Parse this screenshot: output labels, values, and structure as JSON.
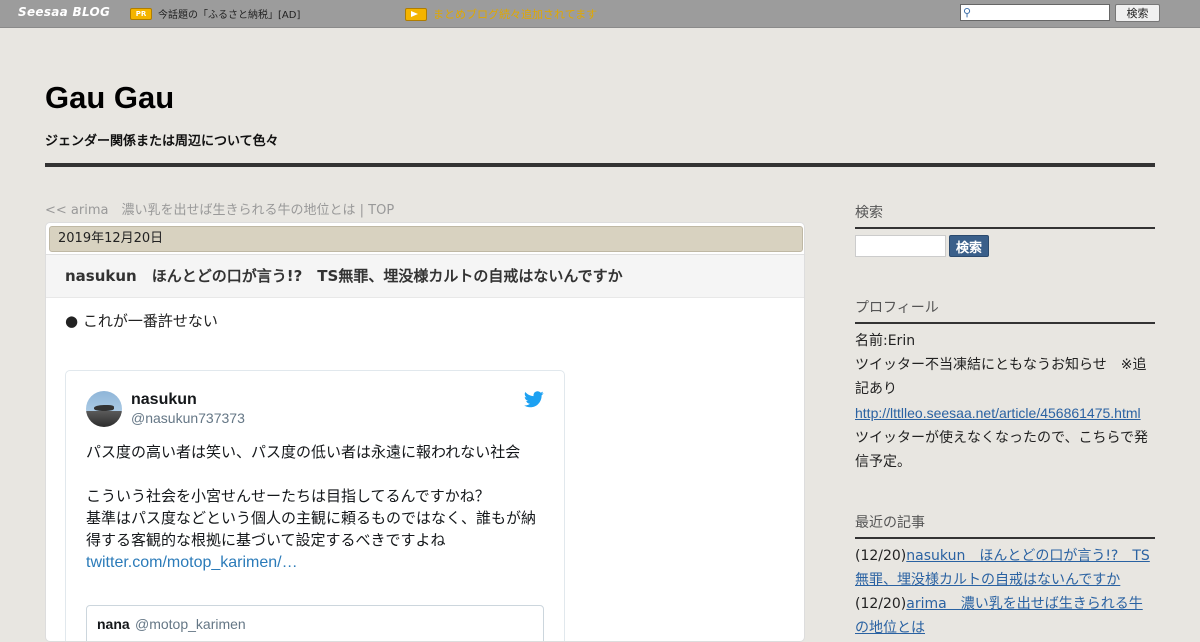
{
  "topbar": {
    "logo": "Seesaa BLOG",
    "pr_badge": "PR",
    "pr_text": "今話題の「ふるさと納税」[AD]",
    "matome_text": "まとめブログ続々追加されてます",
    "search_button": "検索"
  },
  "header": {
    "title": "Gau Gau",
    "subtitle": "ジェンダー関係または周辺について色々"
  },
  "nav": {
    "prev": "<< arima　濃い乳を出せば生きられる牛の地位とは",
    "separator": " | ",
    "top": "TOP"
  },
  "article": {
    "date": "2019年12月20日",
    "title": "nasukun　ほんとどの口が言う!?　TS無罪、埋没様カルトの自戒はないんですか",
    "bullet": "● これが一番許せない"
  },
  "tweet": {
    "name": "nasukun",
    "handle": "@nasukun737373",
    "line1": "パス度の高い者は笑い、パス度の低い者は永遠に報われない社会",
    "line2": "こういう社会を小宮せんせーたちは目指してるんですかね？",
    "line3": "基準はパス度などという個人の主観に頼るものではなく、誰もが納得する客観的な根拠に基づいて設定するべきですよね",
    "link": "twitter.com/motop_karimen/…",
    "quote_name": "nana",
    "quote_handle": "@motop_karimen"
  },
  "sidebar": {
    "search_heading": "検索",
    "search_button": "検索",
    "profile_heading": "プロフィール",
    "profile_name": "名前:Erin",
    "profile_notice": "ツイッター不当凍結にともなうお知らせ　※追記あり",
    "profile_url": "http://lttlleo.seesaa.net/article/456861475.html",
    "profile_note": "ツイッターが使えなくなったので、こちらで発信予定。",
    "recent_heading": "最近の記事",
    "recent": [
      {
        "date": "(12/20)",
        "title": "nasukun　ほんとどの口が言う!?　TS無罪、埋没様カルトの自戒はないんですか"
      },
      {
        "date": "(12/20)",
        "title": "arima　濃い乳を出せば生きられる牛の地位とは"
      }
    ]
  }
}
